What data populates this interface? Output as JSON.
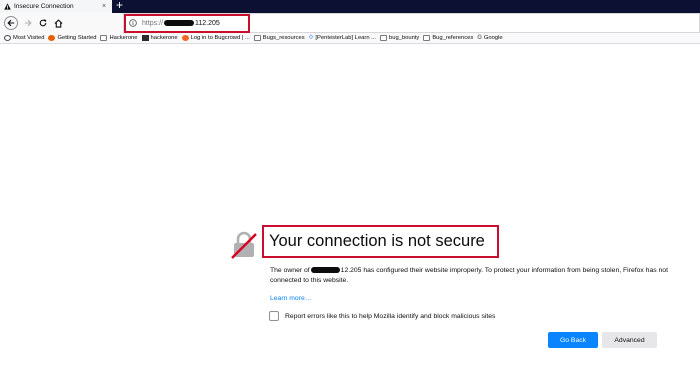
{
  "browser": {
    "tab": {
      "title": "Insecure Connection",
      "close_glyph": "×",
      "icon": "warning-icon"
    },
    "new_tab_glyph": "+",
    "nav": {
      "back_icon": "back-arrow-icon",
      "forward_icon": "forward-arrow-icon",
      "reload_icon": "reload-icon",
      "home_icon": "home-icon"
    },
    "url": {
      "protocol": "https://",
      "host_suffix": "112.205",
      "icon": "info-icon"
    },
    "bookmarks": [
      {
        "label": "Most Visited",
        "icon": "gear-icon"
      },
      {
        "label": "Getting Started",
        "icon": "firefox-icon"
      },
      {
        "label": "Hackerone",
        "icon": "folder-icon"
      },
      {
        "label": "hackerone",
        "icon": "hackerone-icon"
      },
      {
        "label": "Log in to Bugcrowd | ...",
        "icon": "bugcrowd-icon"
      },
      {
        "label": "Bugs_resources",
        "icon": "folder-icon"
      },
      {
        "label": "[PentesterLab] Learn ...",
        "icon": "pentesterlab-icon"
      },
      {
        "label": "bug_bounty",
        "icon": "folder-icon"
      },
      {
        "label": "Bug_references",
        "icon": "folder-icon"
      },
      {
        "label": "Google",
        "icon": "google-icon"
      }
    ]
  },
  "error_page": {
    "icon": "broken-lock-icon",
    "title": "Your connection is not secure",
    "description_prefix": "The owner of",
    "description_suffix": "12.205 has configured their website improperly. To protect your information from being stolen, Firefox has not connected to this website.",
    "learn_more": "Learn more…",
    "report_label": "Report errors like this to help Mozilla identify and block malicious sites",
    "report_checked": false,
    "go_back": "Go Back",
    "advanced": "Advanced"
  },
  "colors": {
    "highlight_border": "#c8102e",
    "primary_button": "#0a84ff",
    "tab_strip": "#0c1032",
    "link": "#0a84ff"
  }
}
